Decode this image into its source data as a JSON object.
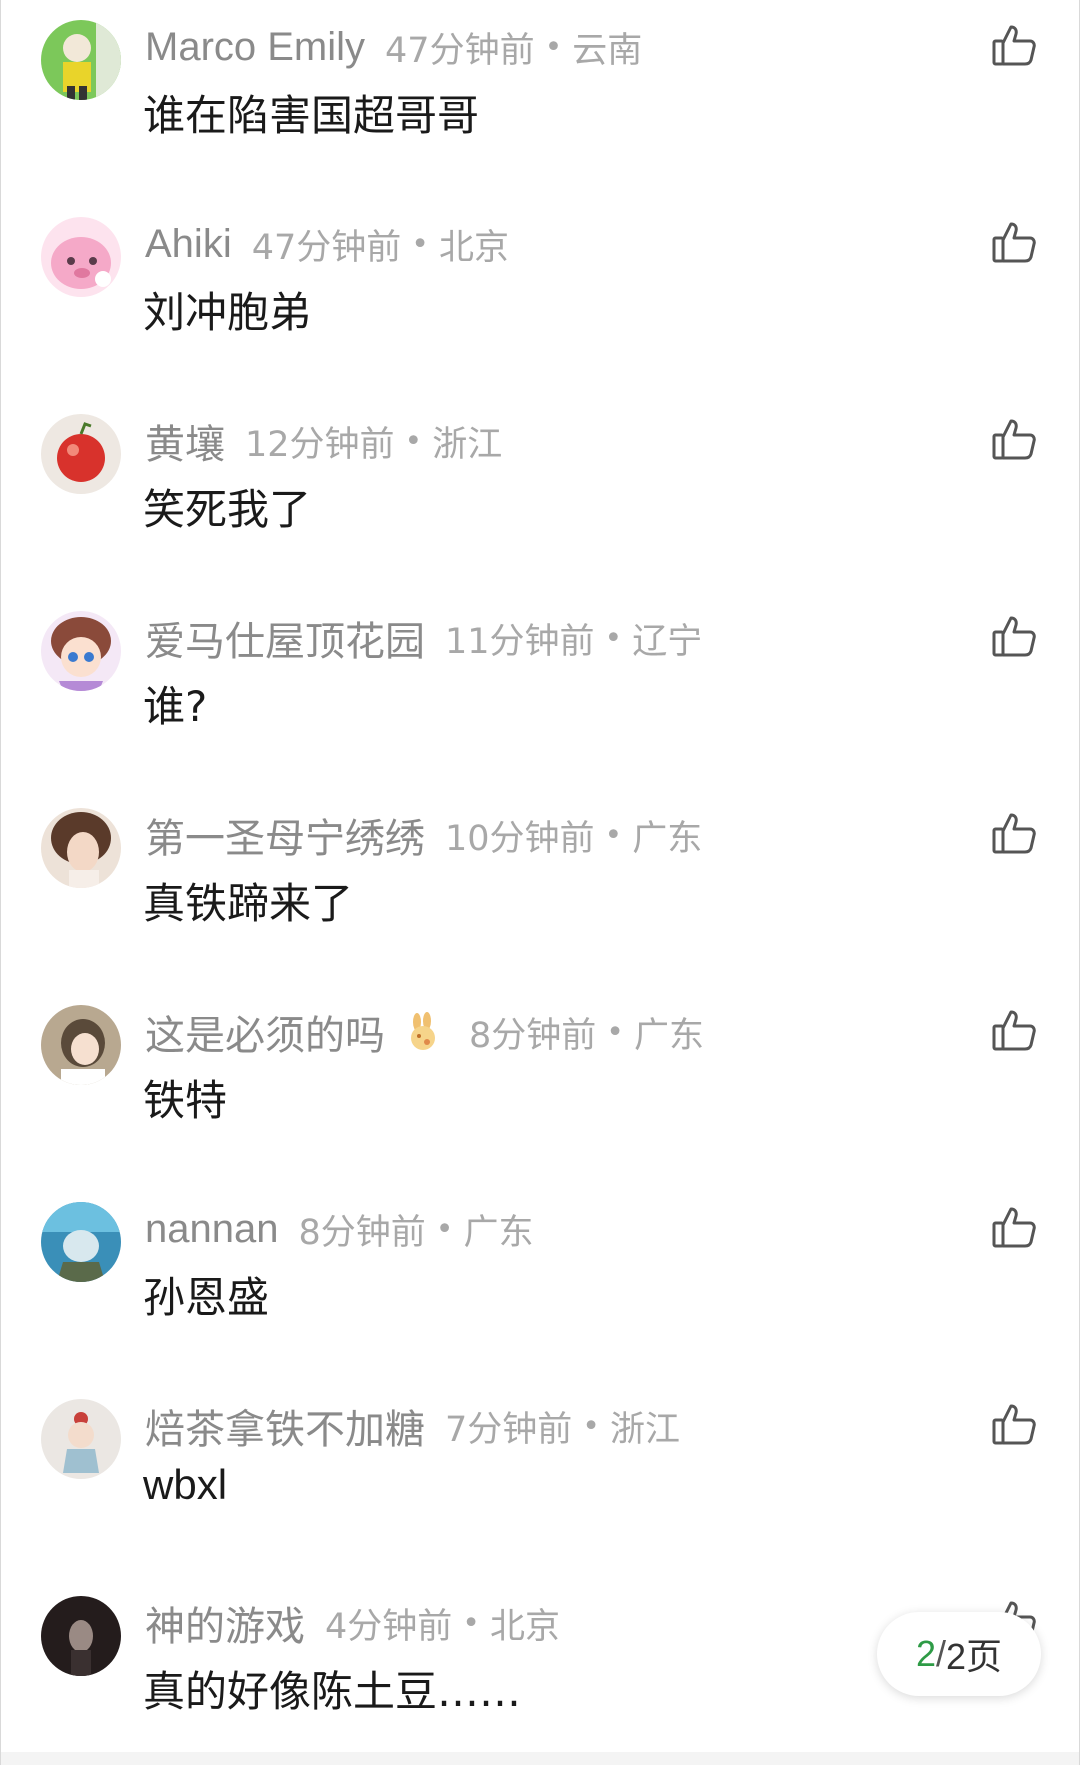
{
  "comments": [
    {
      "name": "Marco Emily",
      "time": "47分钟前",
      "sep": "•",
      "location": "云南",
      "text": "谁在陷害国超哥哥",
      "avatar_color": "#6cc04a"
    },
    {
      "name": "Ahiki",
      "time": "47分钟前",
      "sep": "•",
      "location": "北京",
      "text": "刘冲胞弟",
      "avatar_color": "#f7b6d2"
    },
    {
      "name": "黄壤",
      "time": "12分钟前",
      "sep": "•",
      "location": "浙江",
      "text": "笑死我了",
      "avatar_color": "#d8322c"
    },
    {
      "name": "爱马仕屋顶花园",
      "time": "11分钟前",
      "sep": "•",
      "location": "辽宁",
      "text": "谁?",
      "avatar_color": "#b58ad6"
    },
    {
      "name": "第一圣母宁绣绣",
      "time": "10分钟前",
      "sep": "•",
      "location": "广东",
      "text": "真铁蹄来了",
      "avatar_color": "#c9a58a"
    },
    {
      "name": "这是必须的吗",
      "time": "8分钟前",
      "sep": "•",
      "location": "广东",
      "text": "铁特",
      "avatar_color": "#a89478",
      "emoji": "rabbit-emoji"
    },
    {
      "name": "nannan",
      "time": "8分钟前",
      "sep": "•",
      "location": "广东",
      "text": "孙恩盛",
      "avatar_color": "#4a8fb5"
    },
    {
      "name": "焙茶拿铁不加糖",
      "time": "7分钟前",
      "sep": "•",
      "location": "浙江",
      "text": "wbxl",
      "avatar_color": "#e8e4e0"
    },
    {
      "name": "神的游戏",
      "time": "4分钟前",
      "sep": "•",
      "location": "北京",
      "text": "真的好像陈土豆……",
      "avatar_color": "#2b2323"
    }
  ],
  "pager": {
    "current": "2",
    "slash": "/",
    "total": "2页"
  },
  "colors": {
    "accent": "#2e9b46",
    "meta": "#a8a8a8",
    "text": "#1a1a1a"
  },
  "icons": {
    "like": "thumbs-up-icon"
  }
}
